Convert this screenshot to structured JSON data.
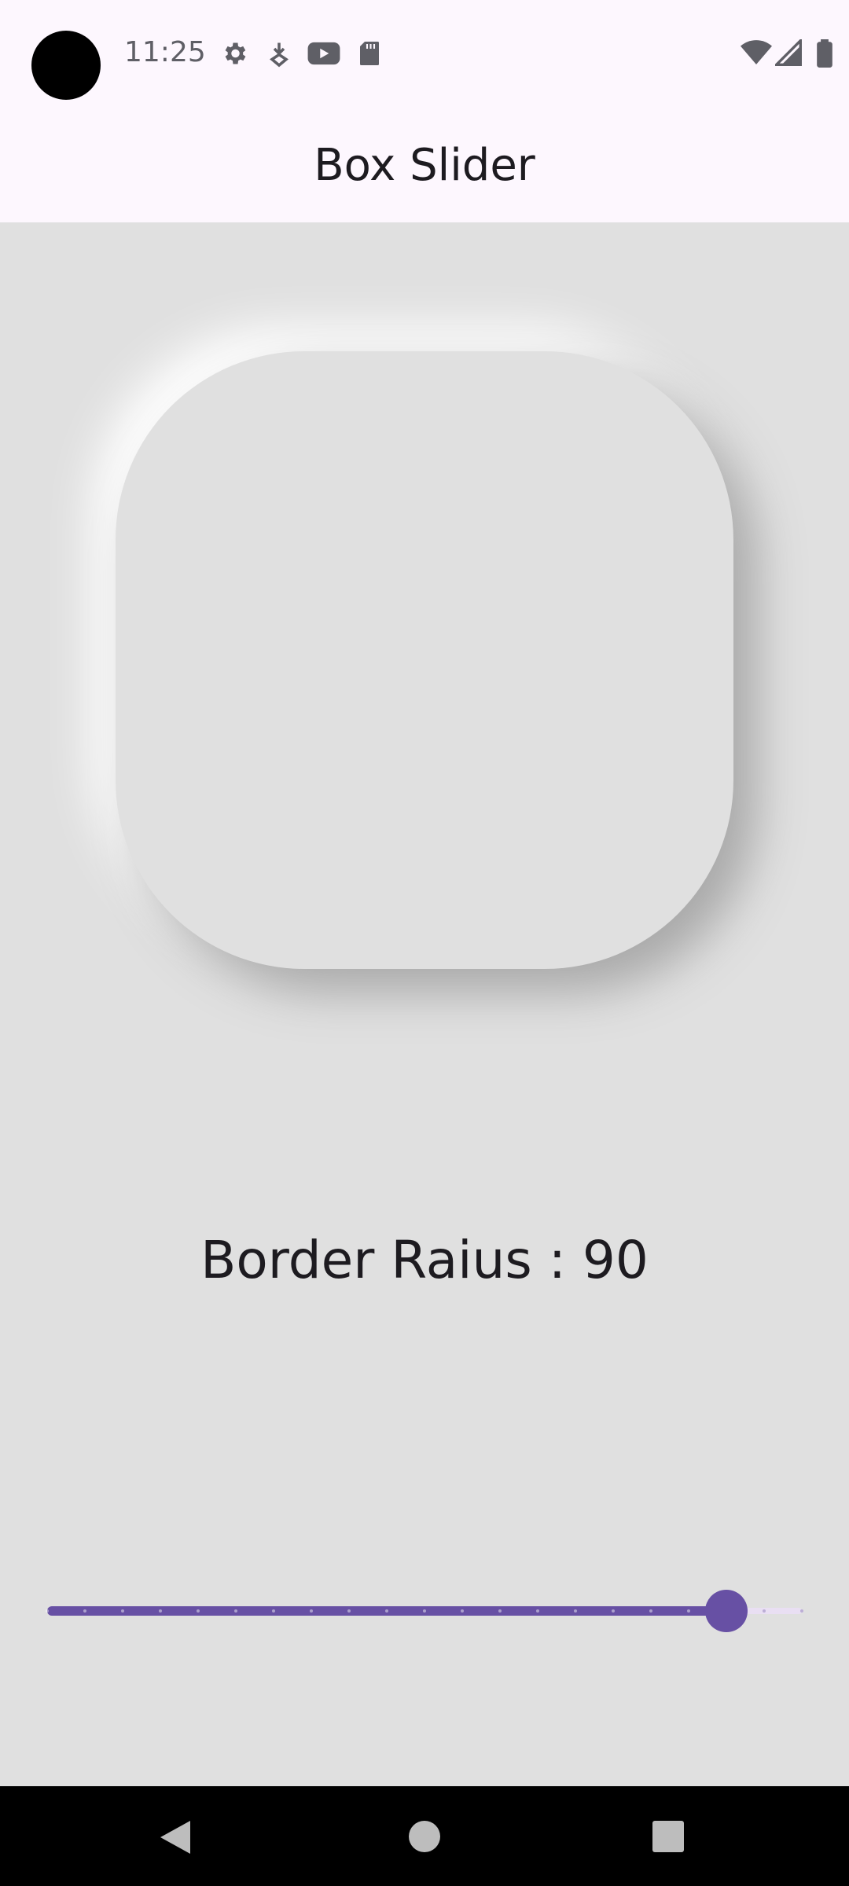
{
  "status_bar": {
    "time": "11:25",
    "left_icons": [
      "gear-icon",
      "download-icon",
      "youtube-icon",
      "sd-card-icon"
    ],
    "right_icons": [
      "wifi-icon",
      "signal-icon",
      "battery-icon"
    ]
  },
  "app_bar": {
    "title": "Box Slider"
  },
  "box": {
    "border_radius": 90
  },
  "label": {
    "text": "Border Raius : 90"
  },
  "slider": {
    "value": 90,
    "min": 0,
    "max": 100,
    "divisions": 20,
    "active_color": "#6750a4"
  },
  "nav_bar": {
    "buttons": [
      "back-icon",
      "home-icon",
      "recents-icon"
    ]
  }
}
